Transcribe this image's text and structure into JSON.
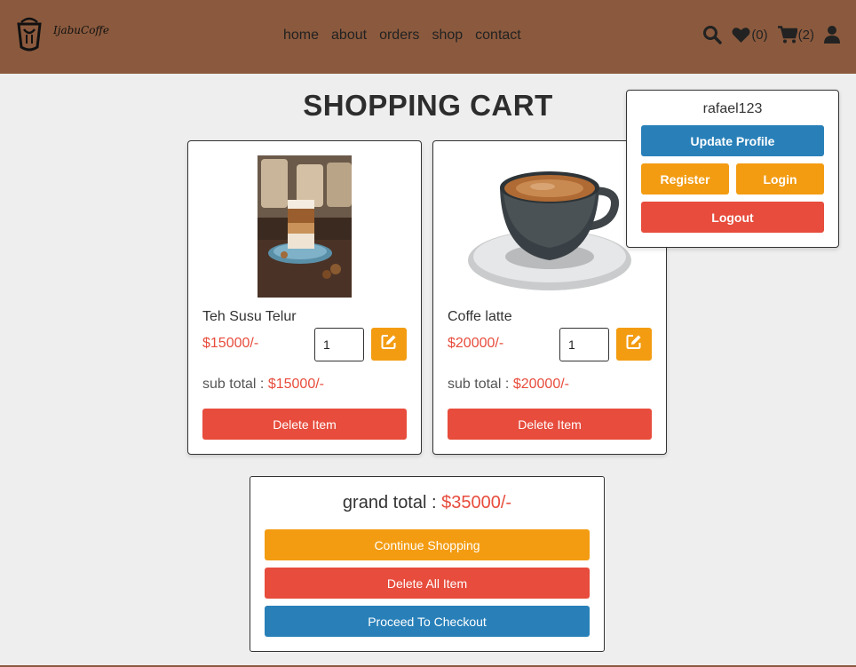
{
  "header": {
    "brand": "IjabuCoffe",
    "nav": [
      "home",
      "about",
      "orders",
      "shop",
      "contact"
    ],
    "wishlist_count": "(0)",
    "cart_count": "(2)"
  },
  "page": {
    "title": "SHOPPING CART"
  },
  "cart": {
    "items": [
      {
        "name": "Teh Susu Telur",
        "price": "$15000/-",
        "quantity": "1",
        "subtotal_label": "sub total : ",
        "subtotal": "$15000/-",
        "delete_label": "Delete Item"
      },
      {
        "name": "Coffe latte",
        "price": "$20000/-",
        "quantity": "1",
        "subtotal_label": "sub total : ",
        "subtotal": "$20000/-",
        "delete_label": "Delete Item"
      }
    ],
    "grand_total_label": "grand total : ",
    "grand_total": "$35000/-",
    "continue_label": "Continue Shopping",
    "delete_all_label": "Delete All Item",
    "checkout_label": "Proceed To Checkout"
  },
  "profile": {
    "username": "rafael123",
    "update_label": "Update Profile",
    "register_label": "Register",
    "login_label": "Login",
    "logout_label": "Logout"
  },
  "colors": {
    "header_bg": "#8b5a3e",
    "orange": "#f39c12",
    "red": "#e74c3c",
    "blue": "#2980b9"
  }
}
